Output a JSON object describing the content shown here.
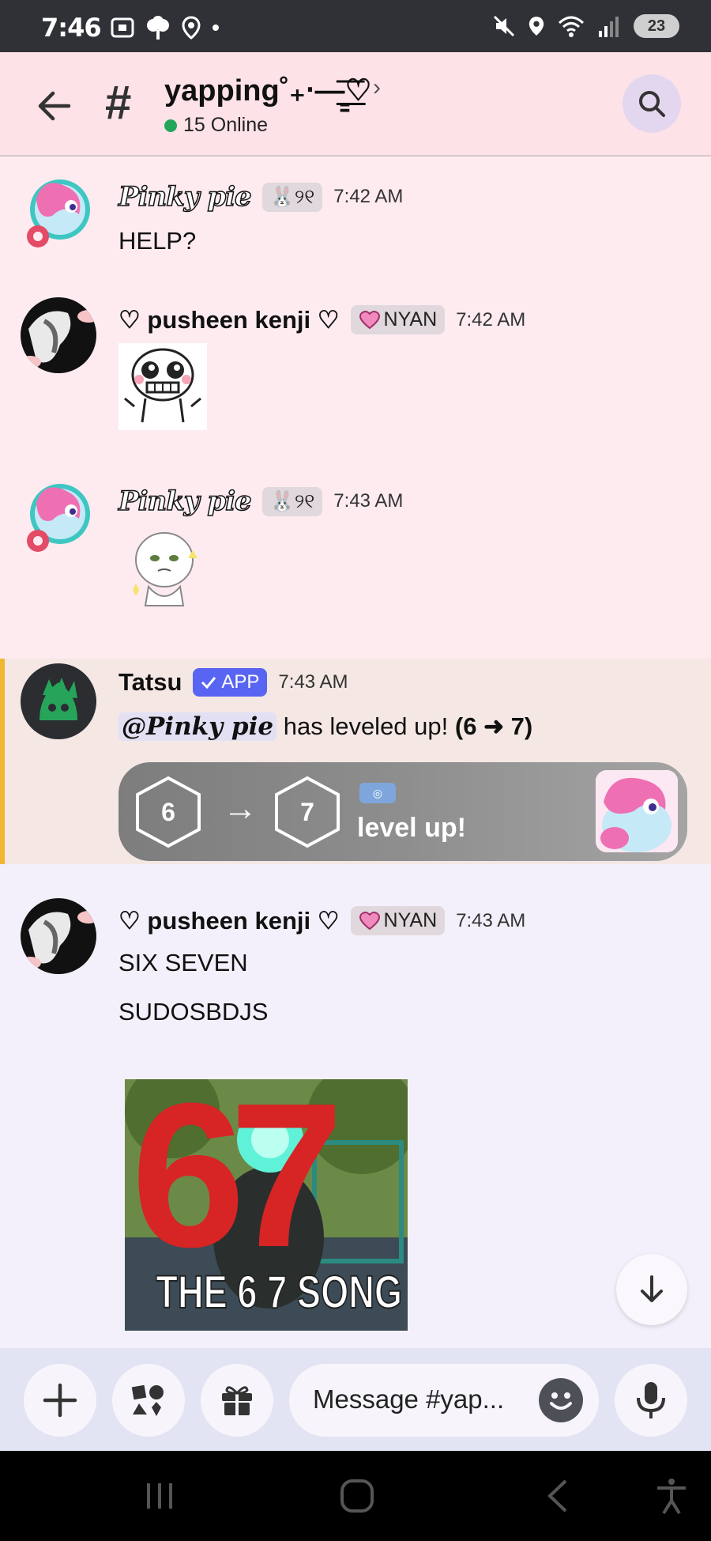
{
  "status_bar": {
    "time": "7:46",
    "battery": "23",
    "left_icons": [
      "screenshot-icon",
      "tree-icon",
      "location-icon",
      "dot-icon"
    ],
    "right_icons": [
      "mute-icon",
      "location-icon",
      "wifi-icon",
      "signal-icon"
    ]
  },
  "header": {
    "channel_name": "yapping˚₊‧—̳͟͞♡",
    "chevron": "›",
    "online_count": "15 Online",
    "hash": "#"
  },
  "messages": [
    {
      "author": "Pinky pie",
      "tag": "🐰୨୧",
      "time": "7:42 AM",
      "text": "HELP?"
    },
    {
      "author": "♡ pusheen kenji ♡",
      "tag": "NYAN",
      "time": "7:42 AM"
    },
    {
      "author": "Pinky pie",
      "tag": "🐰୨୧",
      "time": "7:43 AM"
    },
    {
      "author": "Tatsu",
      "badge": "APP",
      "time": "7:43 AM",
      "mention": "@Pinky pie",
      "text": "has leveled up!",
      "level_change": "(6 ➜ 7)",
      "card": {
        "from_level": "6",
        "to_level": "7",
        "label": "level up!"
      }
    },
    {
      "author": "♡ pusheen kenji ♡",
      "tag": "NYAN",
      "time": "7:43 AM",
      "lines": [
        "SIX SEVEN",
        "SUDOSBDJS"
      ],
      "image_caption": "THE 6 7 SONG",
      "image_numbers": "67"
    }
  ],
  "composer": {
    "placeholder": "Message #yap..."
  },
  "colors": {
    "header_bg": "#fde2e7",
    "chat_bg": "#fdebf0",
    "app_badge": "#5865f2",
    "online_dot": "#23a55a",
    "tatsu_highlight": "#f2b731"
  }
}
